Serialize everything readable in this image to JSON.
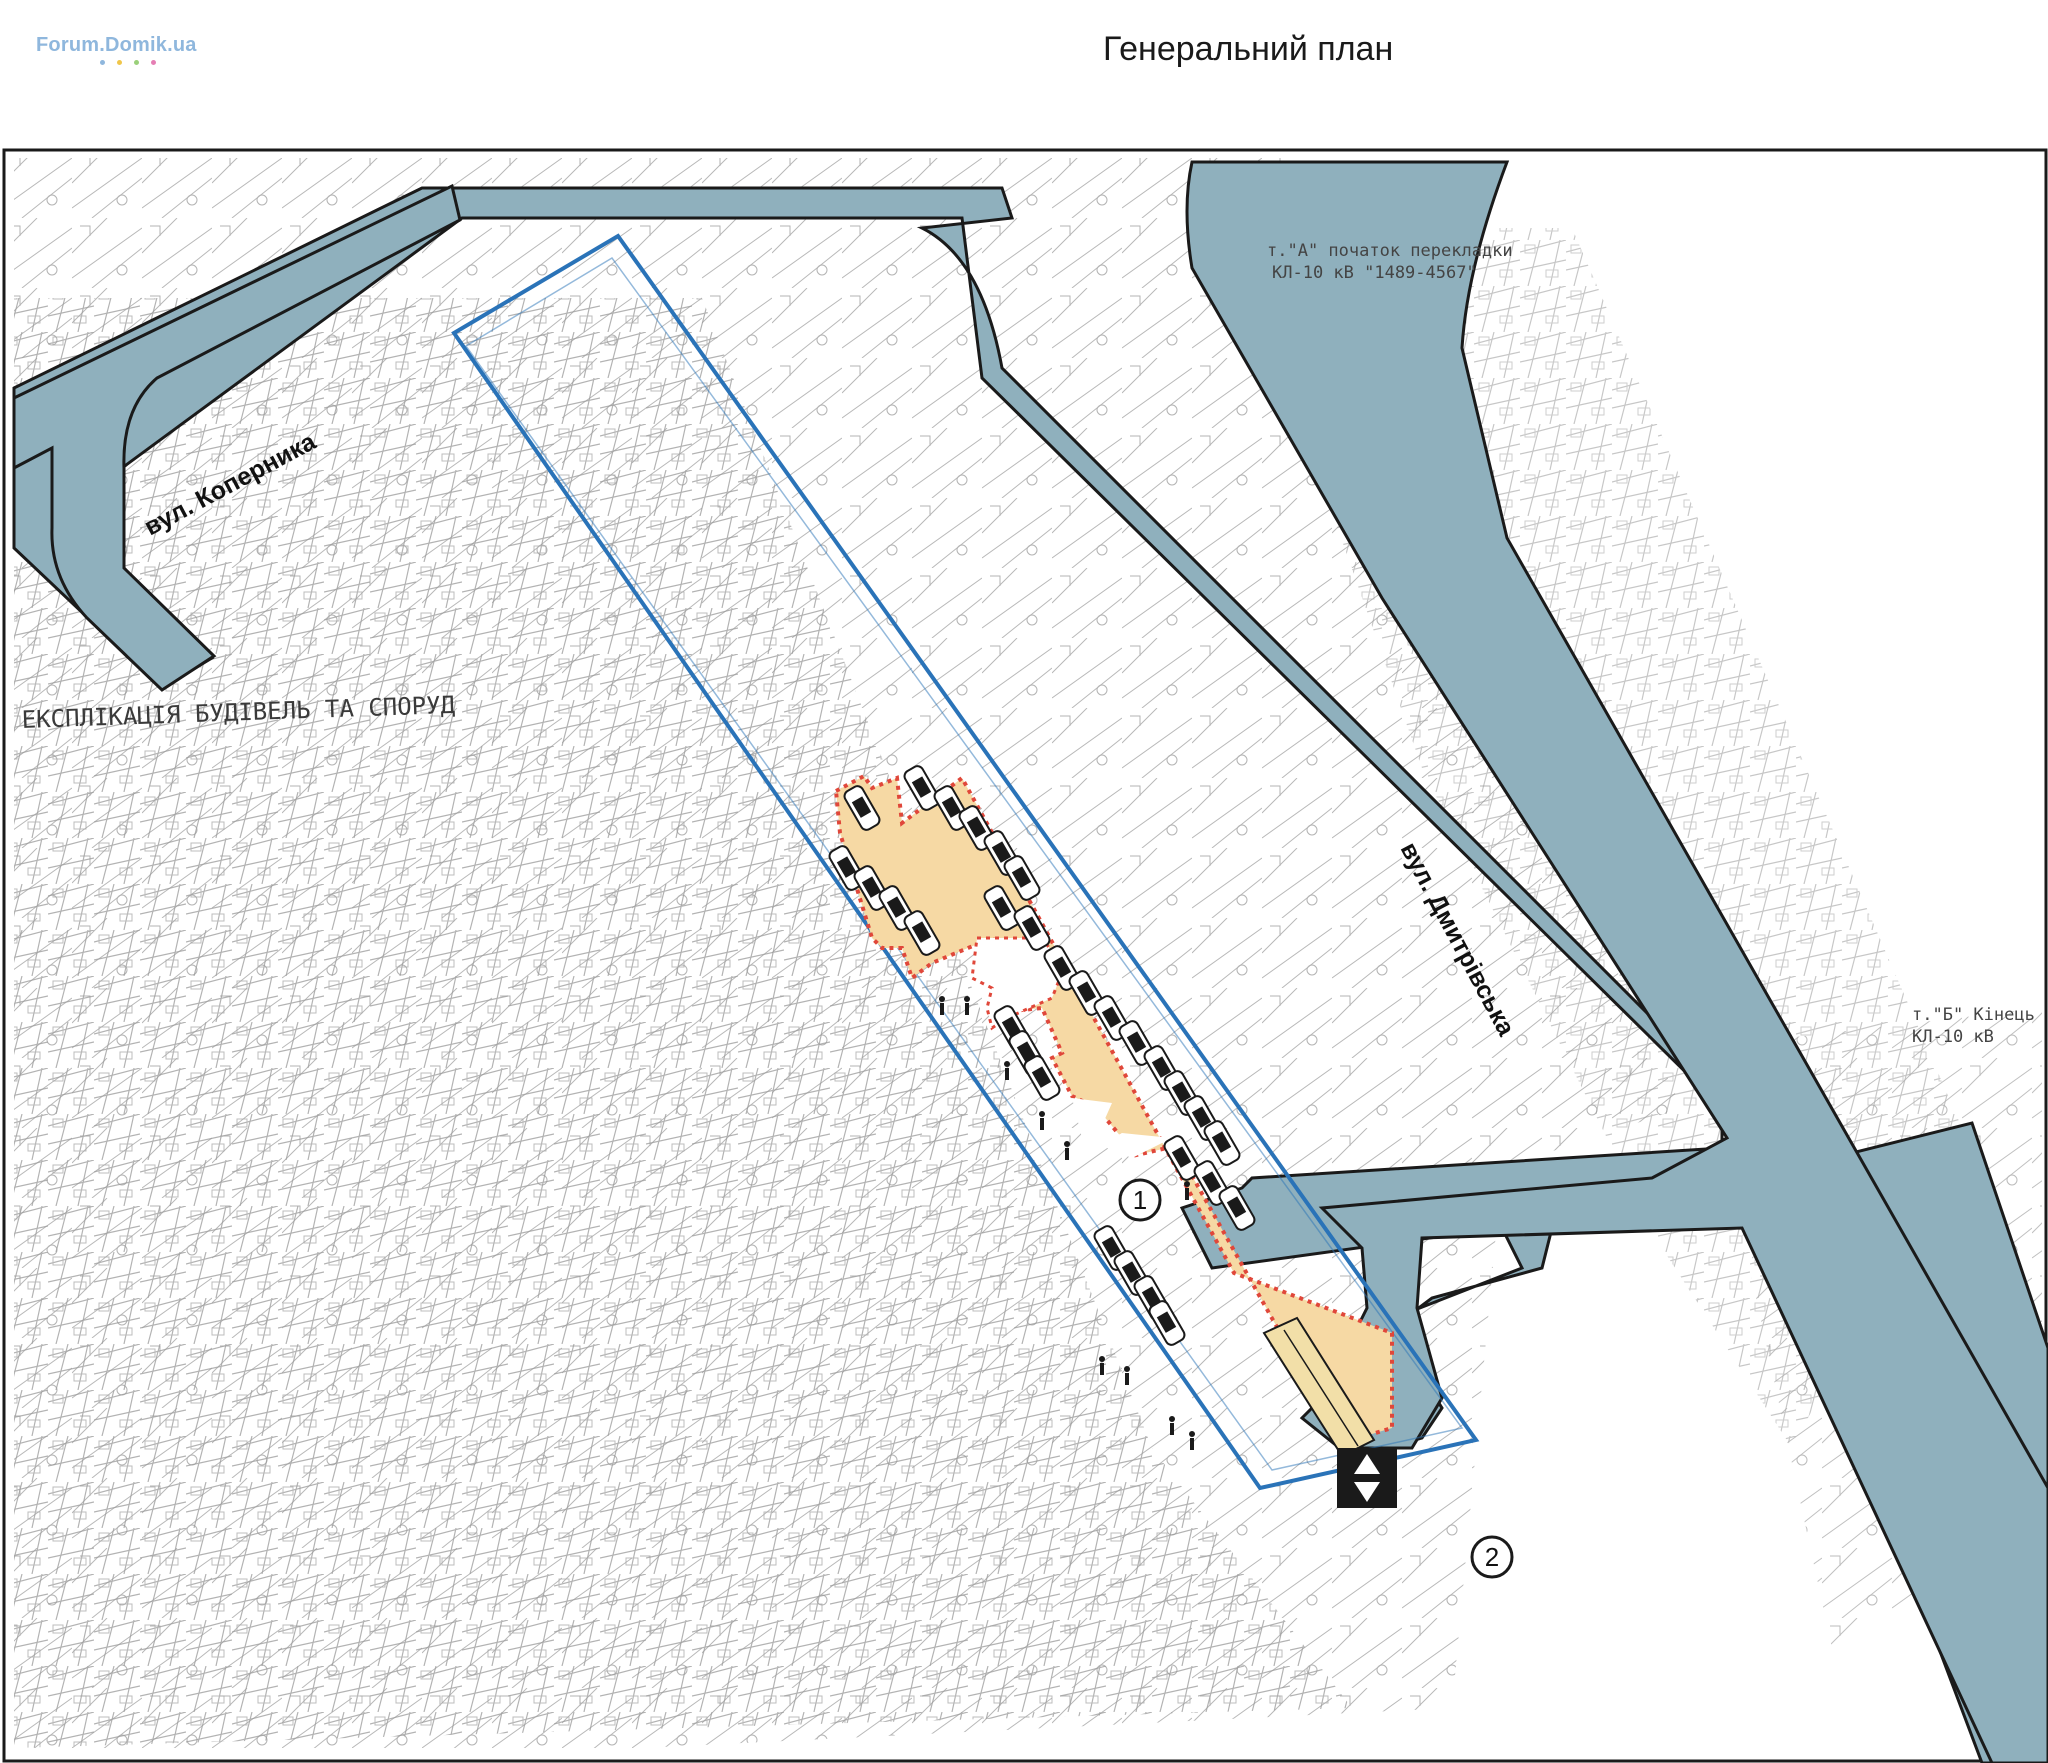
{
  "watermark": {
    "text": "Forum.Domik.ua",
    "dot_colors": [
      "#8fb7dd",
      "#f0c64a",
      "#9ad07a",
      "#e57eb4"
    ]
  },
  "title": "Генеральний план",
  "colors": {
    "street": "#8fb0bd",
    "parking_zone": "#f6d9a4",
    "boundary": "#2a73b8",
    "dotted_border": "#e0473a",
    "ramp": "#f2dfa8"
  },
  "streets": {
    "kopernyka": "вул. Коперника",
    "dmytrivska": "вул. Дмитрівська"
  },
  "markers": [
    {
      "id": "marker-1",
      "label": "1"
    },
    {
      "id": "marker-2",
      "label": "2"
    }
  ],
  "survey_annotations": {
    "explication": "ЕКСПЛІКАЦІЯ БУДІВЕЛЬ ТА СПОРУД",
    "top_right_1": "т.\"А\" початок перекладки",
    "top_right_2": "КЛ-10 кВ \"1489-4567\"",
    "right_1": "т.\"Б\" Кінець",
    "right_2": "КЛ-10 кВ"
  },
  "icons": {
    "entry": "entry-arrow-icon",
    "car": "car-icon",
    "pedestrian": "pedestrian-icon"
  }
}
